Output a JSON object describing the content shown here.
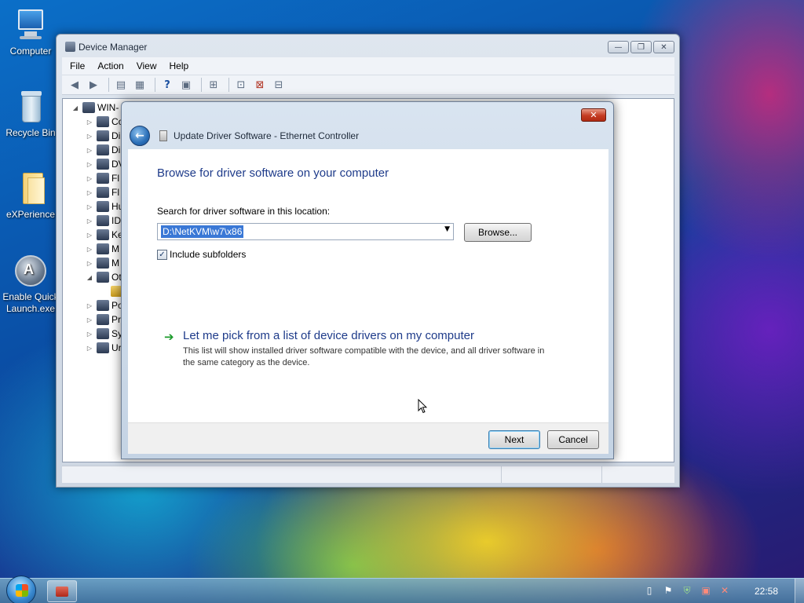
{
  "desktop": {
    "icons": [
      {
        "label": "Computer"
      },
      {
        "label": "Recycle Bin"
      },
      {
        "label": "eXPerience"
      },
      {
        "label": "Enable Quick Launch.exe"
      }
    ]
  },
  "device_manager": {
    "title": "Device Manager",
    "menu": [
      "File",
      "Action",
      "View",
      "Help"
    ],
    "tree": {
      "root": "WIN-",
      "categories": [
        "Co",
        "Di",
        "Di",
        "DV",
        "Fl",
        "Fl",
        "Hu",
        "ID",
        "Ke",
        "M",
        "M",
        "Ot",
        "",
        "Po",
        "Pr",
        "Sy",
        "Ur"
      ]
    }
  },
  "dialog": {
    "title": "Update Driver Software - Ethernet Controller",
    "close_label": "✕",
    "heading": "Browse for driver software on your computer",
    "search_label": "Search for driver software in this location:",
    "path_value": "D:\\NetKVM\\w7\\x86",
    "browse_label": "Browse...",
    "include_subfolders_label": "Include subfolders",
    "include_subfolders_checked": true,
    "pick_link": "Let me pick from a list of device drivers on my computer",
    "pick_description": "This list will show installed driver software compatible with the device, and all driver software in the same category as the device.",
    "next_label": "Next",
    "cancel_label": "Cancel"
  },
  "taskbar": {
    "clock": "22:58"
  },
  "colors": {
    "heading_blue": "#1e3b8a",
    "selection_blue": "#3a78d6",
    "link_arrow_green": "#1a9a2a",
    "close_red": "#c53b22"
  }
}
